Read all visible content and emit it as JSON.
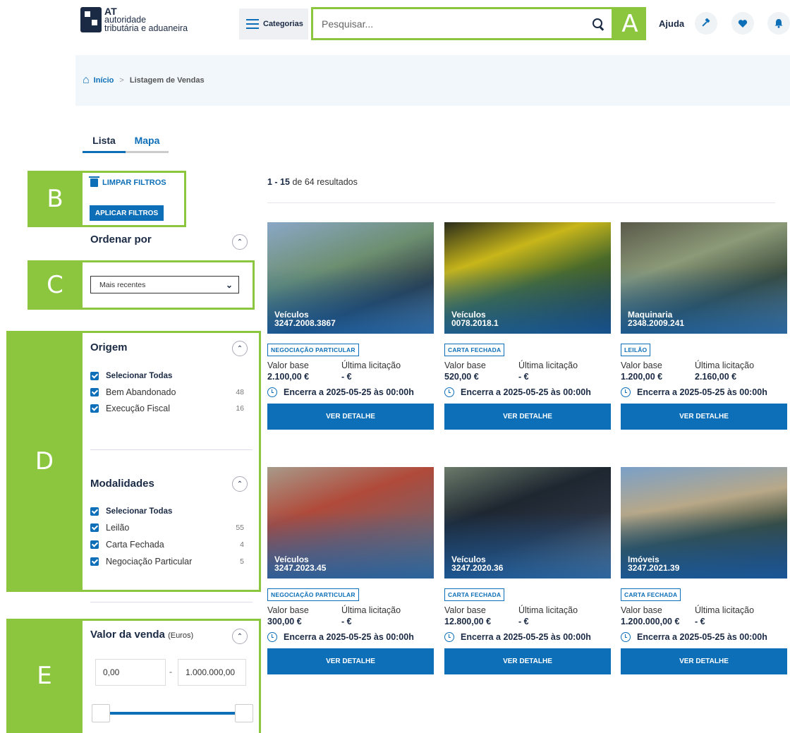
{
  "header": {
    "logo_at": "AT",
    "logo_line1": "autoridade",
    "logo_line2": "tributária e aduaneira",
    "categories_label": "Categorias",
    "search_placeholder": "Pesquisar...",
    "help_label": "Ajuda"
  },
  "annotations": [
    "A",
    "B",
    "C",
    "D",
    "E"
  ],
  "breadcrumb": {
    "home": "Início",
    "separator": ">",
    "current": "Listagem de Vendas"
  },
  "tabs": [
    {
      "label": "Lista",
      "active": true
    },
    {
      "label": "Mapa",
      "active": false
    }
  ],
  "filters": {
    "clear_label": "LIMPAR FILTROS",
    "apply_label": "APLICAR FILTROS",
    "sort": {
      "title": "Ordenar por",
      "selected": "Mais recentes"
    },
    "origem": {
      "title": "Origem",
      "select_all": "Selecionar Todas",
      "items": [
        {
          "label": "Bem Abandonado",
          "count": "48"
        },
        {
          "label": "Execução Fiscal",
          "count": "16"
        }
      ]
    },
    "modalidades": {
      "title": "Modalidades",
      "select_all": "Selecionar Todas",
      "items": [
        {
          "label": "Leilão",
          "count": "55"
        },
        {
          "label": "Carta Fechada",
          "count": "4"
        },
        {
          "label": "Negociação Particular",
          "count": "5"
        }
      ]
    },
    "valor": {
      "title": "Valor da venda",
      "unit": "(Euros)",
      "min": "0,00",
      "dash": "-",
      "max": "1.000.000,00"
    }
  },
  "results": {
    "range": "1 - 15",
    "suffix": "de 64 resultados"
  },
  "labels": {
    "base": "Valor base",
    "last": "Última licitação",
    "button": "VER DETALHE"
  },
  "cards": [
    {
      "category": "Veículos",
      "ref": "3247.2008.3867",
      "badge": "NEGOCIAÇÃO PARTICULAR",
      "base": "2.100,00 €",
      "last": "- €",
      "ends": "Encerra a 2025-05-25 às 00:00h",
      "bg": "linear-gradient(160deg,#8aa7c7 0%,#6d8f70 40%,#2c3a44 70%,#6a7d8c 100%)"
    },
    {
      "category": "Veículos",
      "ref": "0078.2018.1",
      "badge": "CARTA FECHADA",
      "base": "520,00 €",
      "last": "- €",
      "ends": "Encerra a 2025-05-25 às 00:00h",
      "bg": "linear-gradient(160deg,#2a2c1a 0%,#c8b61a 30%,#4a6a2a 55%,#1d2a36 100%)"
    },
    {
      "category": "Maquinaria",
      "ref": "2348.2009.241",
      "badge": "LEILÃO",
      "base": "1.200,00 €",
      "last": "2.160,00 €",
      "ends": "Encerra a 2025-05-25 às 00:00h",
      "bg": "linear-gradient(160deg,#5a5a4a 0%,#8c9a78 35%,#3a4a3a 65%,#6a7a7a 100%)"
    },
    {
      "category": "Veículos",
      "ref": "3247.2023.45",
      "badge": "NEGOCIAÇÃO PARTICULAR",
      "base": "300,00 €",
      "last": "- €",
      "ends": "Encerra a 2025-05-25 às 00:00h",
      "bg": "linear-gradient(160deg,#a89a8a 0%,#b04a3a 35%,#8a5a5a 60%,#707070 100%)"
    },
    {
      "category": "Veículos",
      "ref": "3247.2020.36",
      "badge": "CARTA FECHADA",
      "base": "12.800,00 €",
      "last": "- €",
      "ends": "Encerra a 2025-05-25 às 00:00h",
      "bg": "linear-gradient(160deg,#6a7a6a 0%,#1e2630 35%,#2a3240 60%,#7a7a7a 100%)"
    },
    {
      "category": "Imóveis",
      "ref": "3247.2021.39",
      "badge": "CARTA FECHADA",
      "base": "1.200.000,00 €",
      "last": "- €",
      "ends": "Encerra a 2025-05-25 às 00:00h",
      "bg": "linear-gradient(170deg,#7aa0c8 0%,#b8a888 35%,#3a4a3a 60%,#2a3a5a 100%)"
    }
  ]
}
